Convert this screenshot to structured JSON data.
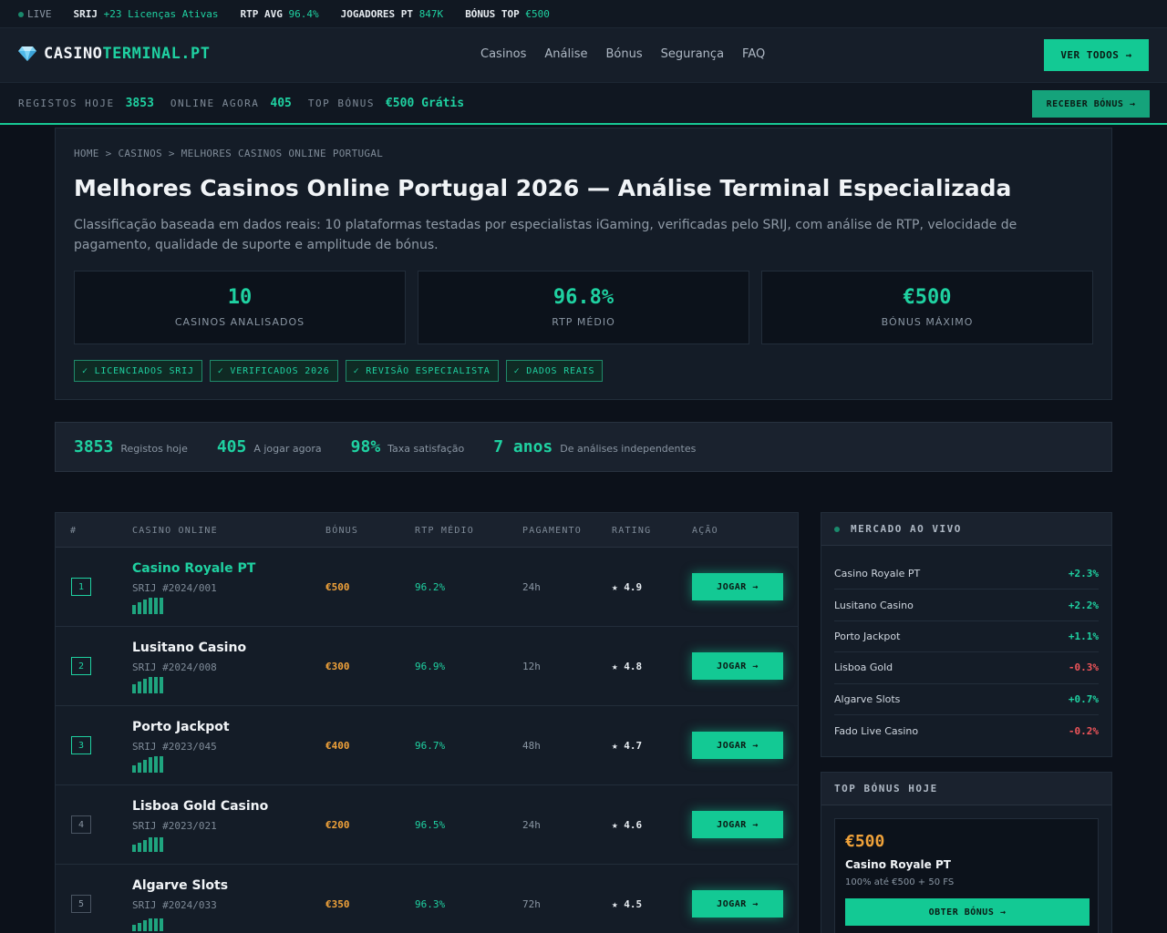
{
  "ticker": {
    "live": "LIVE",
    "srij_label": "SRIJ",
    "srij_value": "+23 Licenças Ativas",
    "rtp_label": "RTP AVG",
    "rtp_value": "96.4%",
    "players_label": "JOGADORES PT",
    "players_value": "847K",
    "bonus_label": "BÓNUS TOP",
    "bonus_value": "€500"
  },
  "header": {
    "logo_a": "CASINO",
    "logo_b": "TERMINAL.PT",
    "nav": [
      "Casinos",
      "Análise",
      "Bónus",
      "Segurança",
      "FAQ"
    ],
    "cta": "VER TODOS →"
  },
  "statsbar": {
    "reg_label": "REGISTOS HOJE",
    "reg_value": "3853",
    "online_label": "ONLINE AGORA",
    "online_value": "405",
    "top_label": "TOP BÓNUS",
    "top_value": "€500 Grátis",
    "cta": "RECEBER BÓNUS →"
  },
  "hero": {
    "breadcrumb": "HOME > CASINOS > MELHORES CASINOS ONLINE PORTUGAL",
    "title": "Melhores Casinos Online Portugal 2026 — Análise Terminal Especializada",
    "description": "Classificação baseada em dados reais: 10 plataformas testadas por especialistas iGaming, verificadas pelo SRIJ, com análise de RTP, velocidade de pagamento, qualidade de suporte e amplitude de bónus.",
    "kpis": [
      {
        "value": "10",
        "label": "CASINOS ANALISADOS"
      },
      {
        "value": "96.8%",
        "label": "RTP MÉDIO"
      },
      {
        "value": "€500",
        "label": "BÓNUS MÁXIMO"
      }
    ],
    "badges": [
      "✓ LICENCIADOS SRIJ",
      "✓ VERIFICADOS 2026",
      "✓ REVISÃO ESPECIALISTA",
      "✓ DADOS REAIS"
    ]
  },
  "counters": [
    {
      "value": "3853",
      "label": "Registos hoje"
    },
    {
      "value": "405",
      "label": "A jogar agora"
    },
    {
      "value": "98%",
      "label": "Taxa satisfação"
    },
    {
      "value": "7 anos",
      "label": "De análises independentes"
    }
  ],
  "table": {
    "headers": [
      "#",
      "CASINO ONLINE",
      "BÓNUS",
      "RTP MÉDIO",
      "PAGAMENTO",
      "RATING",
      "AÇÃO"
    ],
    "rows": [
      {
        "rank": "1",
        "name": "Casino Royale PT",
        "license": "SRIJ #2024/001",
        "bonus": "€500",
        "rtp": "96.2%",
        "pay": "24h",
        "rating": "★ 4.9",
        "action": "JOGAR →"
      },
      {
        "rank": "2",
        "name": "Lusitano Casino",
        "license": "SRIJ #2024/008",
        "bonus": "€300",
        "rtp": "96.9%",
        "pay": "12h",
        "rating": "★ 4.8",
        "action": "JOGAR →"
      },
      {
        "rank": "3",
        "name": "Porto Jackpot",
        "license": "SRIJ #2023/045",
        "bonus": "€400",
        "rtp": "96.7%",
        "pay": "48h",
        "rating": "★ 4.7",
        "action": "JOGAR →"
      },
      {
        "rank": "4",
        "name": "Lisboa Gold Casino",
        "license": "SRIJ #2023/021",
        "bonus": "€200",
        "rtp": "96.5%",
        "pay": "24h",
        "rating": "★ 4.6",
        "action": "JOGAR →"
      },
      {
        "rank": "5",
        "name": "Algarve Slots",
        "license": "SRIJ #2024/033",
        "bonus": "€350",
        "rtp": "96.3%",
        "pay": "72h",
        "rating": "★ 4.5",
        "action": "JOGAR →"
      }
    ]
  },
  "market": {
    "title": "MERCADO AO VIVO",
    "rows": [
      {
        "name": "Casino Royale PT",
        "change": "+2.3%",
        "dir": "up"
      },
      {
        "name": "Lusitano Casino",
        "change": "+2.2%",
        "dir": "up"
      },
      {
        "name": "Porto Jackpot",
        "change": "+1.1%",
        "dir": "up"
      },
      {
        "name": "Lisboa Gold",
        "change": "-0.3%",
        "dir": "down"
      },
      {
        "name": "Algarve Slots",
        "change": "+0.7%",
        "dir": "up"
      },
      {
        "name": "Fado Live Casino",
        "change": "-0.2%",
        "dir": "down"
      }
    ]
  },
  "topbonus": {
    "title": "TOP BÓNUS HOJE",
    "amount": "€500",
    "name": "Casino Royale PT",
    "desc": "100% até €500 + 50 FS",
    "cta": "OBTER BÓNUS →"
  },
  "colors": {
    "accent": "#1fd1a1",
    "bonus": "#f0a23a",
    "negative": "#f0555a",
    "background": "#0c111a"
  }
}
